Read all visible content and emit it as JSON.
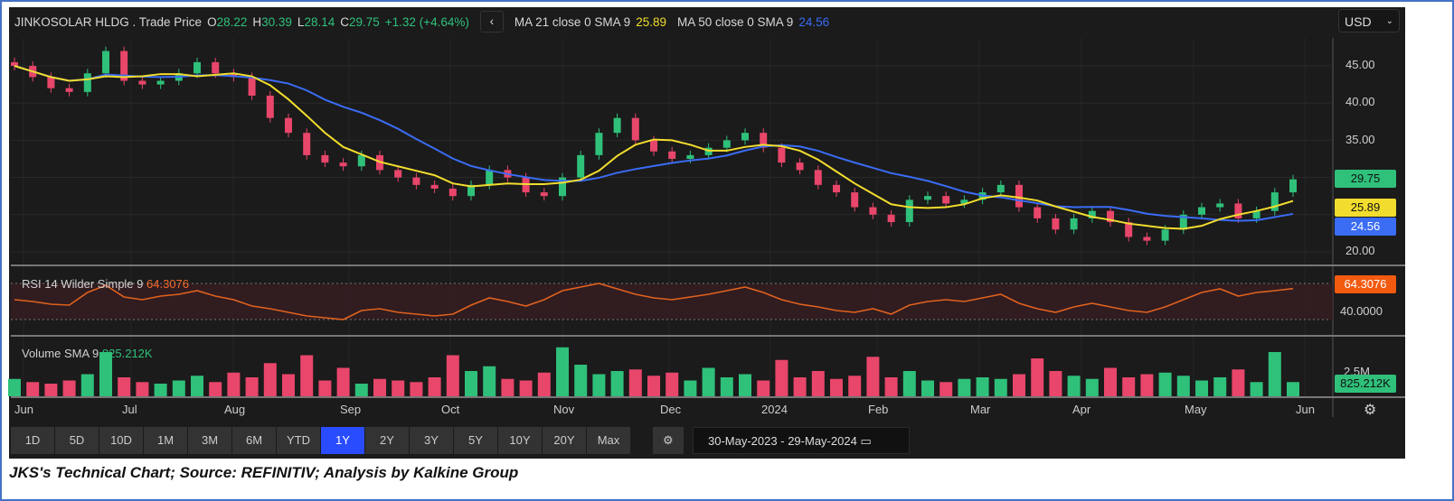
{
  "header": {
    "title": "JINKOSOLAR HLDG . Trade Price",
    "o_label": "O",
    "open": "28.22",
    "h_label": "H",
    "high": "30.39",
    "l_label": "L",
    "low": "28.14",
    "c_label": "C",
    "close": "29.75",
    "change": "+1.32 (+4.64%)",
    "back_icon": "chevron-left-icon",
    "ma21_label": "MA 21 close 0 SMA 9",
    "ma21_value": "25.89",
    "ma50_label": "MA 50 close 0 SMA 9",
    "ma50_value": "24.56"
  },
  "currency": "USD",
  "price_axis": [
    "45.00",
    "40.00",
    "35.00",
    "20.00"
  ],
  "price_tags": {
    "close": "29.75",
    "ma21": "25.89",
    "ma50": "24.56"
  },
  "rsi": {
    "label": "RSI 14 Wilder Simple 9",
    "value": "64.3076",
    "axis": "40.0000"
  },
  "volume": {
    "label": "Volume SMA 9",
    "value": "825.212K",
    "axis": "2.5M",
    "tag": "825.212K"
  },
  "months": [
    "Jun",
    "Jul",
    "Aug",
    "Sep",
    "Oct",
    "Nov",
    "Dec",
    "2024",
    "Feb",
    "Mar",
    "Apr",
    "May",
    "Jun"
  ],
  "ranges": [
    "1D",
    "5D",
    "10D",
    "1M",
    "3M",
    "6M",
    "YTD",
    "1Y",
    "2Y",
    "3Y",
    "5Y",
    "10Y",
    "20Y",
    "Max"
  ],
  "active_range": "1Y",
  "date_range": {
    "from": "30-May-2023",
    "sep": "-",
    "to": "29-May-2024"
  },
  "caption": "JKS's Technical Chart; Source: REFINITIV; Analysis by Kalkine Group",
  "colors": {
    "up": "#2fc07a",
    "down": "#e8466a",
    "ma21": "#f2dd2e",
    "ma50": "#3a6cf4",
    "rsi": "#e0621e"
  },
  "chart_data": {
    "type": "candlestick",
    "title": "JINKOSOLAR HLDG . Trade Price",
    "ylim": [
      18,
      48
    ],
    "closes": [
      45,
      43.5,
      42,
      41.5,
      44,
      47,
      43,
      42.5,
      43,
      44,
      45.5,
      44,
      43.5,
      41,
      38,
      36,
      33,
      32,
      31.5,
      33,
      31,
      30,
      29,
      28.5,
      27.5,
      29,
      31,
      30,
      28,
      27.5,
      30,
      33,
      36,
      38,
      35,
      33.5,
      32.5,
      33,
      34,
      35,
      36,
      34,
      32,
      31,
      29,
      28,
      26,
      25,
      24,
      27,
      27.5,
      26.5,
      27,
      28,
      29,
      26,
      24.5,
      23,
      24.5,
      25.5,
      24,
      22,
      21.5,
      23,
      25,
      26,
      26.5,
      24.5,
      25.5,
      28,
      29.75
    ],
    "rsi": [
      52,
      50,
      47,
      46,
      60,
      68,
      55,
      52,
      56,
      58,
      62,
      56,
      52,
      45,
      42,
      38,
      34,
      32,
      30,
      40,
      42,
      38,
      36,
      34,
      36,
      46,
      54,
      50,
      45,
      52,
      62,
      66,
      70,
      64,
      58,
      54,
      52,
      55,
      58,
      62,
      66,
      60,
      52,
      47,
      44,
      40,
      38,
      42,
      36,
      46,
      50,
      52,
      50,
      54,
      58,
      48,
      42,
      38,
      44,
      48,
      44,
      40,
      38,
      44,
      52,
      60,
      64,
      56,
      60,
      62,
      64.3
    ],
    "volumes": [
      1.1,
      0.9,
      0.8,
      1.0,
      1.4,
      2.8,
      1.2,
      0.9,
      0.8,
      1.0,
      1.3,
      0.9,
      1.5,
      1.2,
      2.1,
      1.4,
      2.6,
      1.0,
      1.8,
      0.8,
      1.1,
      1.0,
      0.9,
      1.2,
      2.6,
      1.6,
      1.9,
      1.1,
      1.0,
      1.5,
      3.1,
      2.0,
      1.4,
      1.6,
      1.7,
      1.3,
      1.5,
      1.0,
      1.8,
      1.2,
      1.4,
      1.0,
      2.3,
      1.2,
      1.6,
      1.1,
      1.3,
      2.5,
      1.2,
      1.6,
      1.0,
      0.9,
      1.1,
      1.2,
      1.1,
      1.4,
      2.4,
      1.6,
      1.3,
      1.1,
      1.8,
      1.2,
      1.4,
      1.5,
      1.3,
      1.0,
      1.2,
      1.7,
      0.9,
      2.8,
      0.9
    ],
    "price_axis_ticks": [
      20,
      25,
      30,
      35,
      40,
      45
    ],
    "rsi_levels": [
      30,
      70
    ],
    "ma_windows_note": "MA 21 and MA 50 overlays"
  }
}
